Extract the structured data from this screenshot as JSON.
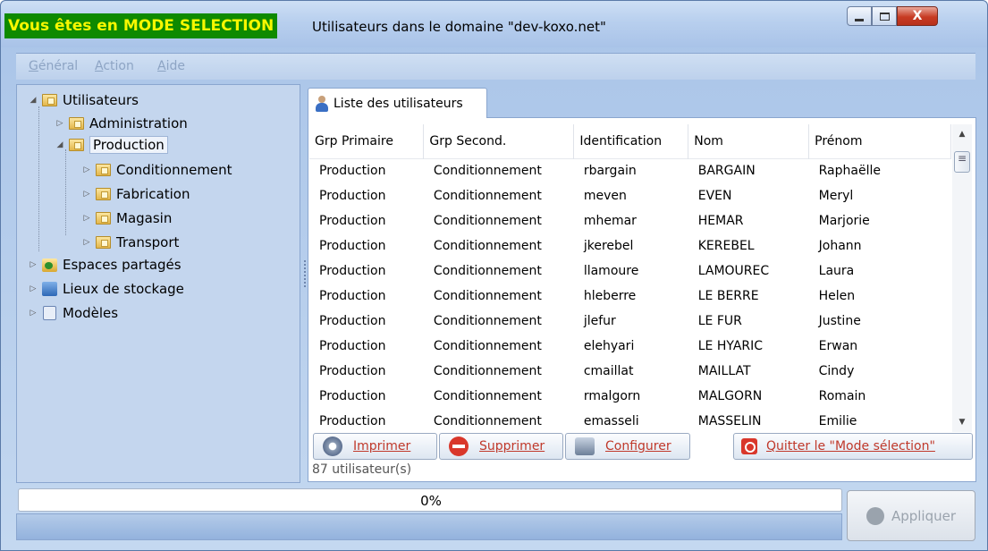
{
  "titlebar": {
    "mode_banner": "Vous êtes en MODE SELECTION",
    "title": "Utilisateurs dans le domaine \"dev-koxo.net\"",
    "close_glyph": "X"
  },
  "menu": {
    "items": [
      "Général",
      "Action",
      "Aide"
    ]
  },
  "tree": {
    "root": "Utilisateurs",
    "nodes": {
      "administration": "Administration",
      "production": "Production",
      "conditionnement": "Conditionnement",
      "fabrication": "Fabrication",
      "magasin": "Magasin",
      "transport": "Transport",
      "espaces": "Espaces partagés",
      "lieux": "Lieux de stockage",
      "modeles": "Modèles"
    },
    "selected": "Production"
  },
  "tab": {
    "label": "Liste des utilisateurs"
  },
  "table": {
    "columns": [
      "Grp Primaire",
      "Grp Second.",
      "Identification",
      "Nom",
      "Prénom"
    ],
    "rows": [
      [
        "Production",
        "Conditionnement",
        "rbargain",
        "BARGAIN",
        "Raphaëlle"
      ],
      [
        "Production",
        "Conditionnement",
        "meven",
        "EVEN",
        "Meryl"
      ],
      [
        "Production",
        "Conditionnement",
        "mhemar",
        "HEMAR",
        "Marjorie"
      ],
      [
        "Production",
        "Conditionnement",
        "jkerebel",
        "KEREBEL",
        "Johann"
      ],
      [
        "Production",
        "Conditionnement",
        "llamoure",
        "LAMOUREC",
        "Laura"
      ],
      [
        "Production",
        "Conditionnement",
        "hleberre",
        "LE BERRE",
        "Helen"
      ],
      [
        "Production",
        "Conditionnement",
        "jlefur",
        "LE FUR",
        "Justine"
      ],
      [
        "Production",
        "Conditionnement",
        "elehyari",
        "LE HYARIC",
        "Erwan"
      ],
      [
        "Production",
        "Conditionnement",
        "cmaillat",
        "MAILLAT",
        "Cindy"
      ],
      [
        "Production",
        "Conditionnement",
        "rmalgorn",
        "MALGORN",
        "Romain"
      ],
      [
        "Production",
        "Conditionnement",
        "emasseli",
        "MASSELIN",
        "Emilie"
      ]
    ]
  },
  "actions": {
    "print": "Imprimer",
    "delete": "Supprimer",
    "configure": "Configurer",
    "quit": "Quitter le \"Mode sélection\""
  },
  "count_text": "87 utilisateur(s)",
  "progress": {
    "text": "0%",
    "fraction": 0
  },
  "apply_label": "Appliquer",
  "colors": {
    "banner_bg": "#0e8a00",
    "banner_fg": "#f7f700",
    "action_text": "#c0392b"
  }
}
